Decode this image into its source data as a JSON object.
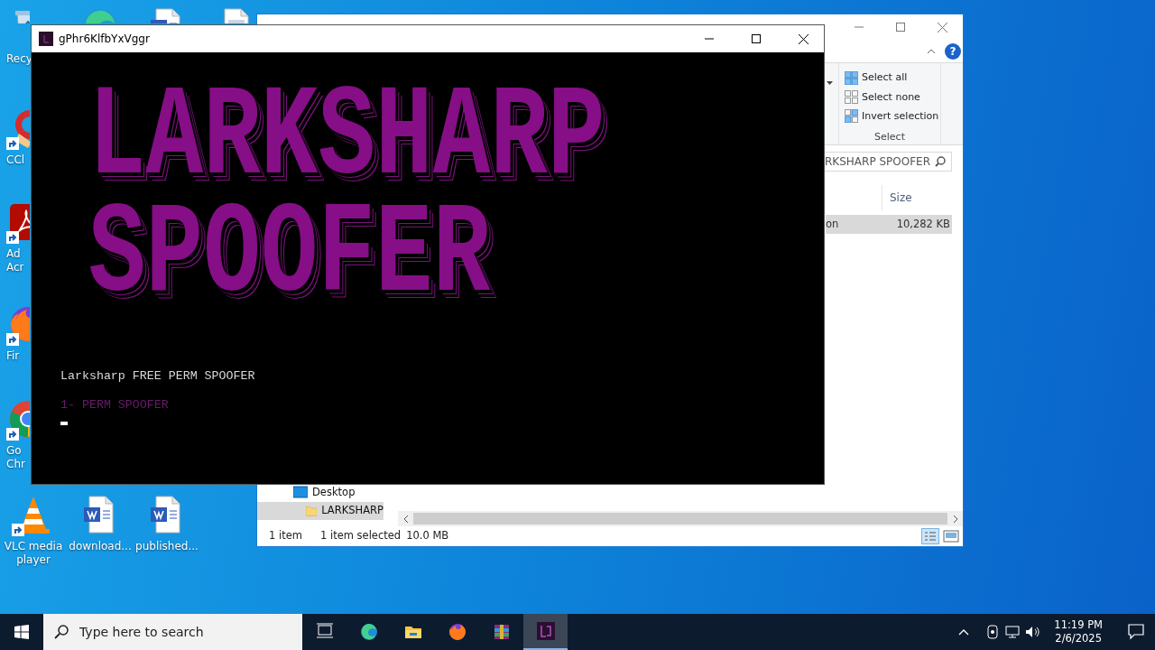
{
  "desktop_icons": [
    {
      "kind": "bin",
      "shortcut": false,
      "label": [
        "Recy"
      ]
    },
    {
      "kind": "swirl",
      "shortcut": false
    },
    {
      "kind": "word",
      "shortcut": false
    },
    {
      "kind": "doc",
      "shortcut": false
    },
    {
      "kind": "broom",
      "shortcut": true,
      "label": [
        "CCl"
      ]
    },
    {
      "kind": "pdf",
      "shortcut": true,
      "label": [
        "Ad",
        "Acr"
      ]
    },
    {
      "kind": "fox",
      "shortcut": true,
      "label": [
        "Fir"
      ]
    },
    {
      "kind": "chrome",
      "shortcut": true,
      "label": [
        "Go",
        "Chr"
      ]
    },
    {
      "kind": "cone",
      "shortcut": true,
      "label": [
        "VLC media",
        "player"
      ]
    },
    {
      "kind": "word",
      "shortcut": false,
      "label": [
        "download..."
      ]
    },
    {
      "kind": "word",
      "shortcut": false,
      "label": [
        "published..."
      ]
    }
  ],
  "explorer": {
    "select_group": {
      "title": "Select",
      "items": [
        {
          "kind": "all",
          "label": "Select all"
        },
        {
          "kind": "none",
          "label": "Select none"
        },
        {
          "kind": "invert",
          "label": "Invert selection"
        }
      ]
    },
    "search": {
      "placeholder": "RKSHARP SPOOFER"
    },
    "help": "?",
    "columns": [
      "",
      "Size"
    ],
    "rows": [
      {
        "cells": [
          "on",
          "10,282 KB"
        ],
        "selected": true
      }
    ],
    "nav": [
      {
        "label": "Desktop",
        "kind": "desktop",
        "selected": false,
        "children": [
          {
            "label": "LARKSHARP",
            "kind": "folder",
            "selected": true
          }
        ]
      }
    ],
    "status_bar": [
      "1 item",
      "1 item selected",
      "10.0 MB"
    ]
  },
  "console": {
    "title": "gPhr6KlfbYxVggr",
    "banner": [
      "LARKSHARP",
      "SPOOFER"
    ],
    "lines": [
      {
        "kind": "plain",
        "text": "Larksharp FREE PERM SPOOFER"
      },
      {
        "kind": "menu",
        "text": "1- PERM SPOOFER"
      }
    ],
    "cursor": true
  },
  "taskbar": {
    "search": {
      "placeholder": "Type here to search"
    },
    "apps": [
      {
        "kind": "taskview",
        "selected": false
      },
      {
        "kind": "edge",
        "selected": false
      },
      {
        "kind": "folder",
        "selected": false
      },
      {
        "kind": "fox",
        "selected": false
      },
      {
        "kind": "archive",
        "selected": false
      },
      {
        "kind": "spoofer",
        "selected": true
      }
    ],
    "clock": {
      "time": "11:19 PM",
      "date": "2/6/2025"
    }
  }
}
